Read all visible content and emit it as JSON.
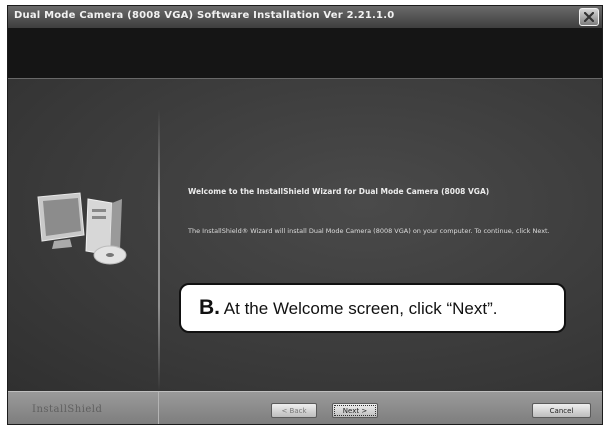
{
  "window": {
    "title": "Dual Mode Camera (8008 VGA) Software Installation Ver 2.21.1.0"
  },
  "welcome": {
    "heading": "Welcome to the InstallShield Wizard for Dual Mode Camera (8008 VGA)",
    "body": "The InstallShield® Wizard will install Dual Mode Camera (8008 VGA) on your computer. To continue, click Next."
  },
  "callout": {
    "step": "B.",
    "text": "At the Welcome screen, click “Next”."
  },
  "footer": {
    "logo": "InstallShield",
    "back_label": "< Back",
    "next_label": "Next >",
    "cancel_label": "Cancel"
  },
  "icons": {
    "close": "close-icon",
    "computer": "computer-setup-icon"
  }
}
